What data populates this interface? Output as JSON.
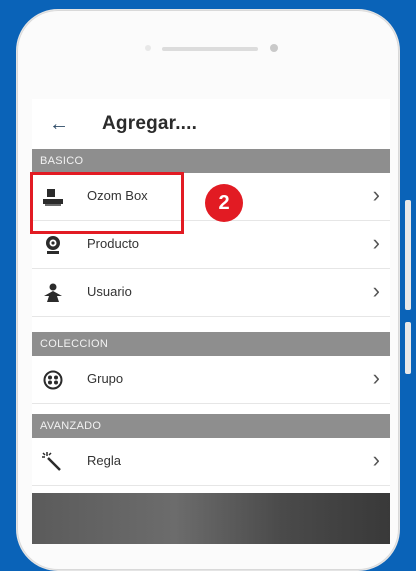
{
  "header": {
    "title": "Agregar...."
  },
  "sections": [
    {
      "title": "BASICO",
      "items": [
        {
          "label": "Ozom Box",
          "icon": "box-icon"
        },
        {
          "label": "Producto",
          "icon": "camera-icon"
        },
        {
          "label": "Usuario",
          "icon": "user-icon"
        }
      ]
    },
    {
      "title": "COLECCION",
      "items": [
        {
          "label": "Grupo",
          "icon": "group-icon"
        }
      ]
    },
    {
      "title": "AVANZADO",
      "items": [
        {
          "label": "Regla",
          "icon": "magic-wand-icon"
        }
      ]
    }
  ],
  "annotation": {
    "step": "2",
    "color": "#e21b23"
  },
  "colors": {
    "background": "#0a63b8",
    "section": "#8e8e8e"
  }
}
